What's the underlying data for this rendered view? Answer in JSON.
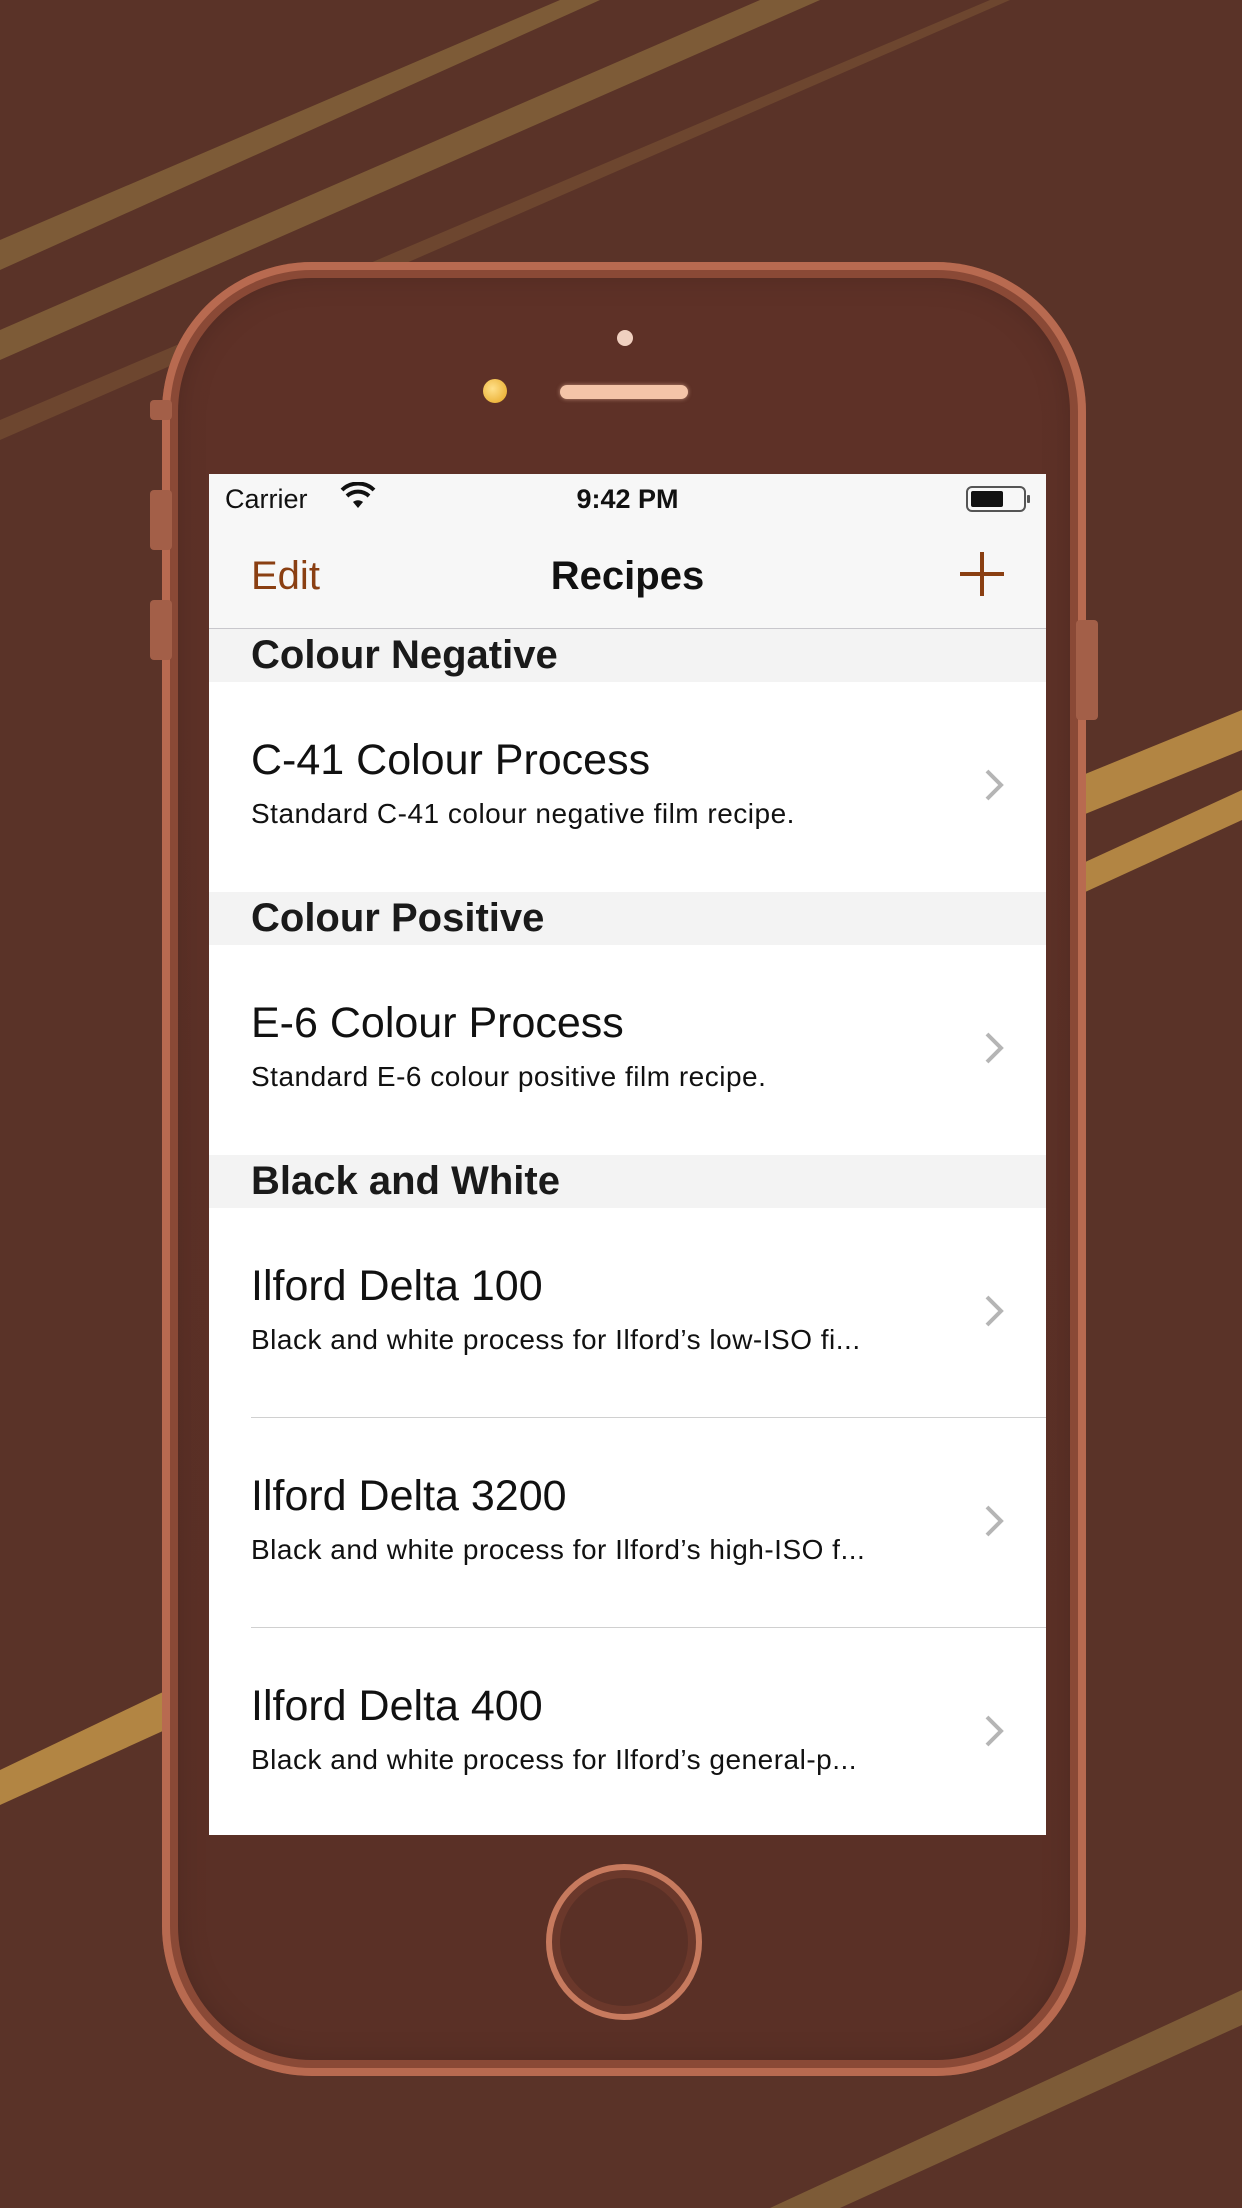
{
  "colors": {
    "background": "#5a3328",
    "accent": "#8a3f12",
    "phone_frame": "#b86a50",
    "stripe": "#8a6a3c"
  },
  "status_bar": {
    "carrier": "Carrier",
    "time": "9:42 PM",
    "wifi_icon": "wifi-icon",
    "battery_icon": "battery-icon"
  },
  "nav": {
    "edit_label": "Edit",
    "title": "Recipes",
    "add_icon": "plus-icon"
  },
  "sections": [
    {
      "title": "Colour Negative",
      "items": [
        {
          "title": "C-41 Colour Process",
          "subtitle": "Standard C-41 colour negative film recipe."
        }
      ]
    },
    {
      "title": "Colour Positive",
      "items": [
        {
          "title": "E-6 Colour Process",
          "subtitle": "Standard E-6 colour positive film recipe."
        }
      ]
    },
    {
      "title": "Black and White",
      "items": [
        {
          "title": "Ilford Delta 100",
          "subtitle": "Black and white process for Ilford’s low-ISO fi..."
        },
        {
          "title": "Ilford Delta 3200",
          "subtitle": "Black and white process for Ilford’s high-ISO f..."
        },
        {
          "title": "Ilford Delta 400",
          "subtitle": "Black and white process for Ilford’s general-p..."
        }
      ]
    }
  ]
}
